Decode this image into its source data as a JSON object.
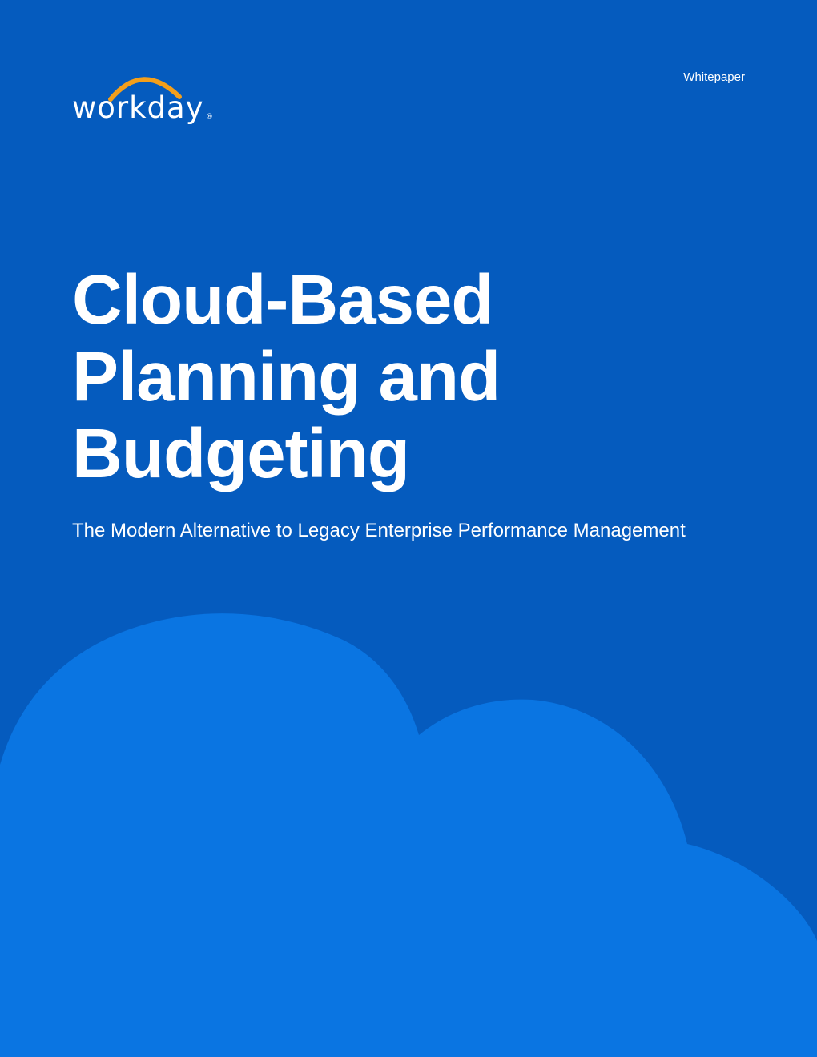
{
  "brand": {
    "logo_text": "workday",
    "registered_mark": "®",
    "arc_color": "#f49f1b"
  },
  "header": {
    "document_type": "Whitepaper"
  },
  "cover": {
    "title_lines": [
      "Cloud-Based",
      "Planning and",
      "Budgeting"
    ],
    "subtitle": "The Modern Alternative to Legacy Enterprise Performance Management"
  },
  "colors": {
    "background": "#055bbe",
    "cloud": "#0a75e2",
    "text": "#ffffff"
  },
  "decorative": {
    "illustration_icon": "cloud-shape"
  }
}
